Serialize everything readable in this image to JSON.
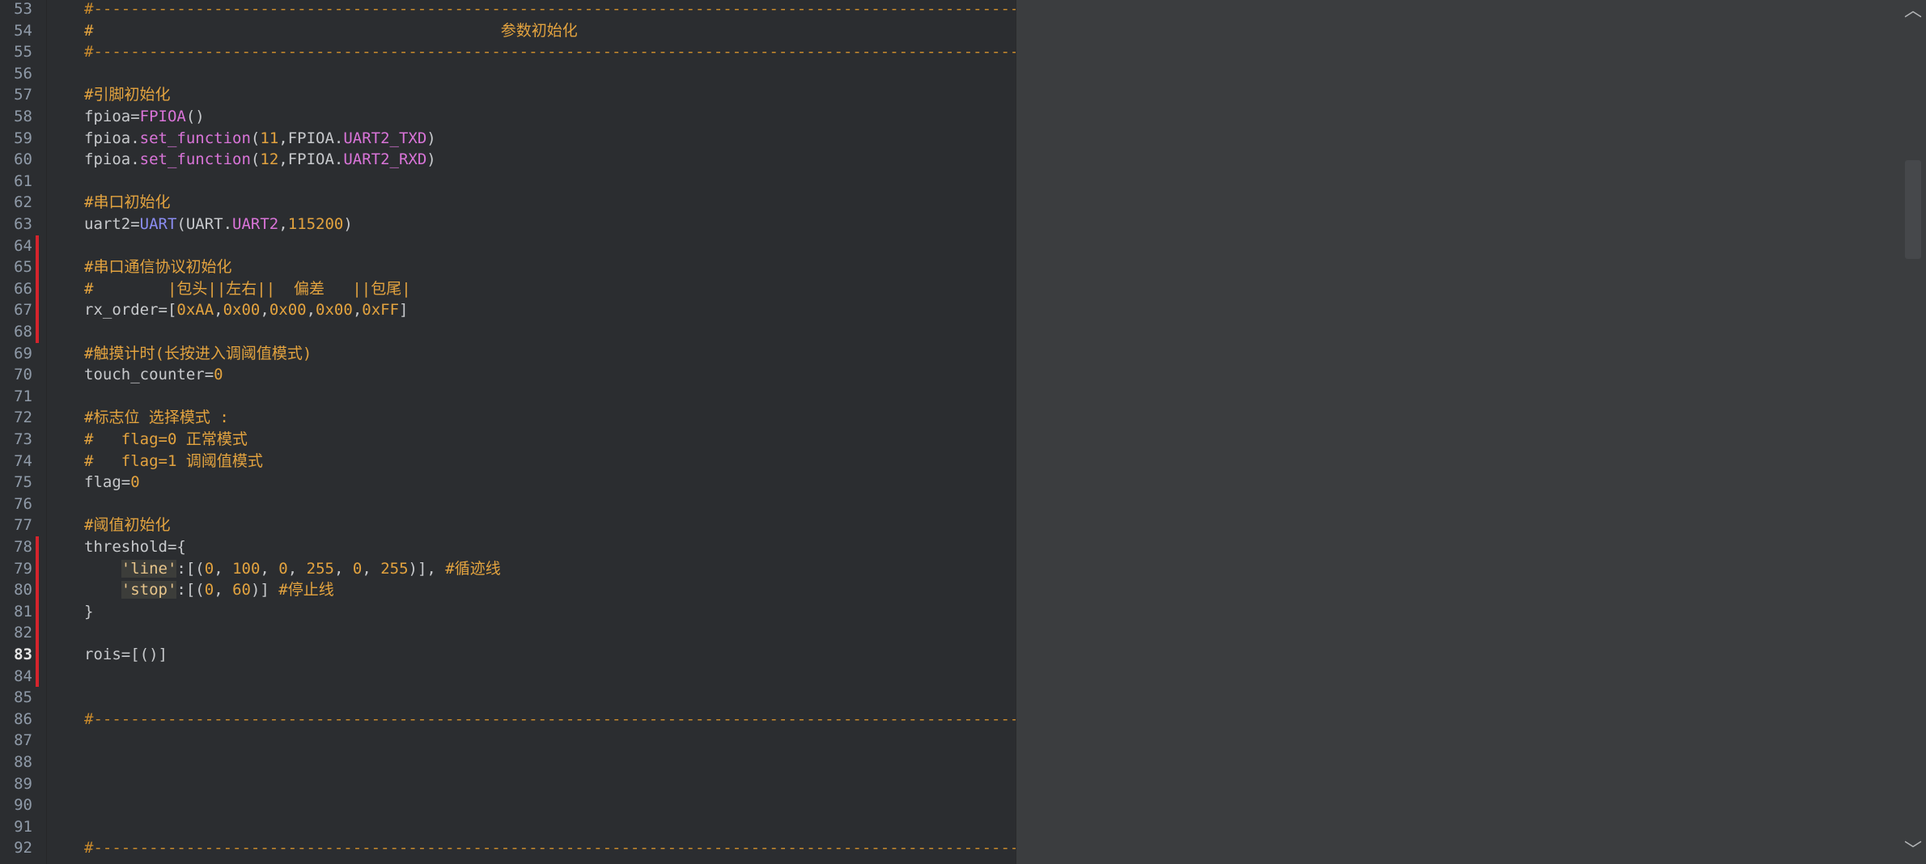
{
  "lines": [
    {
      "n": "53",
      "text": "#-----------------------------------------------------------------------------------------------------------",
      "mod": false
    },
    {
      "n": "54",
      "text": "#                                            参数初始化",
      "mod": false
    },
    {
      "n": "55",
      "text": "#-----------------------------------------------------------------------------------------------------------",
      "mod": false
    },
    {
      "n": "56",
      "text": "",
      "mod": false
    },
    {
      "n": "57",
      "text": "#引脚初始化",
      "mod": false
    },
    {
      "n": "58",
      "text": "fpioa=FPIOA()",
      "mod": false
    },
    {
      "n": "59",
      "text": "fpioa.set_function(11,FPIOA.UART2_TXD)",
      "mod": false
    },
    {
      "n": "60",
      "text": "fpioa.set_function(12,FPIOA.UART2_RXD)",
      "mod": false
    },
    {
      "n": "61",
      "text": "",
      "mod": false
    },
    {
      "n": "62",
      "text": "#串口初始化",
      "mod": false
    },
    {
      "n": "63",
      "text": "uart2=UART(UART.UART2,115200)",
      "mod": false
    },
    {
      "n": "64",
      "text": "",
      "mod": true
    },
    {
      "n": "65",
      "text": "#串口通信协议初始化",
      "mod": true
    },
    {
      "n": "66",
      "text": "#        |包头||左右||  偏差   ||包尾|",
      "mod": true
    },
    {
      "n": "67",
      "text": "rx_order=[0xAA,0x00,0x00,0x00,0xFF]",
      "mod": true
    },
    {
      "n": "68",
      "text": "",
      "mod": true
    },
    {
      "n": "69",
      "text": "#触摸计时(长按进入调阈值模式)",
      "mod": false
    },
    {
      "n": "70",
      "text": "touch_counter=0",
      "mod": false
    },
    {
      "n": "71",
      "text": "",
      "mod": false
    },
    {
      "n": "72",
      "text": "#标志位 选择模式 :",
      "mod": false
    },
    {
      "n": "73",
      "text": "#   flag=0 正常模式",
      "mod": false
    },
    {
      "n": "74",
      "text": "#   flag=1 调阈值模式",
      "mod": false
    },
    {
      "n": "75",
      "text": "flag=0",
      "mod": false
    },
    {
      "n": "76",
      "text": "",
      "mod": false
    },
    {
      "n": "77",
      "text": "#阈值初始化",
      "mod": false
    },
    {
      "n": "78",
      "text": "threshold={",
      "mod": true
    },
    {
      "n": "79",
      "text": "    'line':[(0, 100, 0, 255, 0, 255)], #循迹线",
      "mod": true
    },
    {
      "n": "80",
      "text": "    'stop':[(0, 60)] #停止线",
      "mod": true
    },
    {
      "n": "81",
      "text": "}",
      "mod": true
    },
    {
      "n": "82",
      "text": "",
      "mod": true
    },
    {
      "n": "83",
      "text": "rois=[()]",
      "mod": true,
      "current": true
    },
    {
      "n": "84",
      "text": "",
      "mod": true
    },
    {
      "n": "85",
      "text": "",
      "mod": false
    },
    {
      "n": "86",
      "text": "#-----------------------------------------------------------------------------------------------------------",
      "mod": false
    },
    {
      "n": "87",
      "text": "",
      "mod": false
    },
    {
      "n": "88",
      "text": "",
      "mod": false
    },
    {
      "n": "89",
      "text": "",
      "mod": false
    },
    {
      "n": "90",
      "text": "",
      "mod": false
    },
    {
      "n": "91",
      "text": "",
      "mod": false
    },
    {
      "n": "92",
      "text": "#-----------------------------------------------------------------------------------------------------------",
      "mod": false
    }
  ],
  "colors": {
    "comment": "#e3a33f",
    "function": "#d974d8",
    "class": "#8a8cf0",
    "number": "#e3a33f",
    "modified_bar": "#d5242c"
  },
  "icons": {
    "scroll_up": "chevron-up-icon",
    "scroll_down": "chevron-down-icon"
  }
}
